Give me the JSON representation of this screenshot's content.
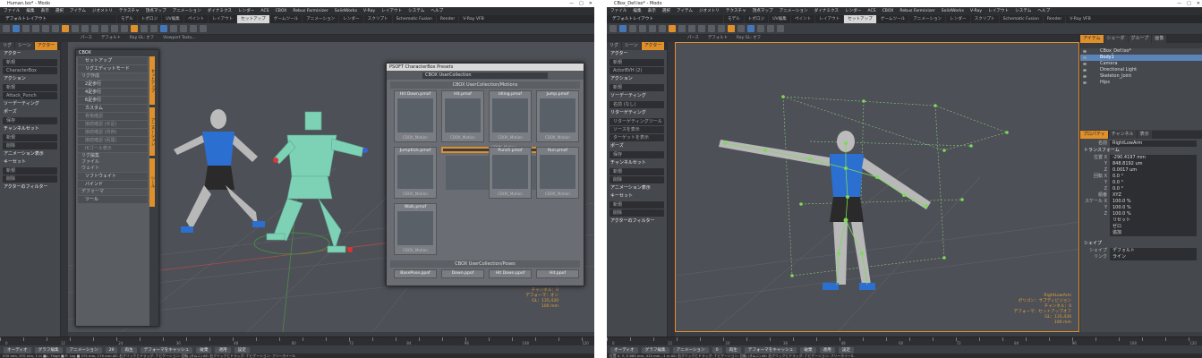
{
  "left": {
    "title": "Human.lxo* - Modo",
    "menu": [
      "ファイル",
      "編集",
      "表示",
      "選択",
      "アイテム",
      "ジオメトリ",
      "テクスチャ",
      "頂点マップ",
      "アニメーション",
      "ダイナミクス",
      "レンダー",
      "ACS",
      "CBOX",
      "Rebus Farminizer",
      "SolidWorks",
      "V-Ray",
      "レイアウト",
      "システム",
      "ヘルプ"
    ],
    "layout_label": "デフォルトレイアウト",
    "tabs": [
      "モデル",
      "トポロジ",
      "UV編集",
      "ペイント",
      "レイアウト",
      "セットアップ",
      "ゲームツール",
      "アニメーション",
      "レンダー",
      "スクリプト",
      "Schematic Fusion",
      "Render",
      "V-Ray VFB"
    ],
    "active_tab": "セットアップ",
    "vp_tabs": [
      "パース",
      "デフォルト",
      "Ray GL: オフ",
      "Viewport Textu..."
    ],
    "panel": {
      "tabs": [
        "リグ",
        "シーン",
        "アクター"
      ],
      "rows": [
        "アクター",
        "新規",
        "CharacterBox",
        "アクション",
        "新規",
        "Attack_Punch",
        "ソーデーティング",
        "ポーズ",
        "保存",
        "チャンネルセット",
        "新規",
        "削除",
        "アニメーション表示",
        "キーセット",
        "新規",
        "削除",
        "アクターのフィルター"
      ]
    },
    "cbox": {
      "title": "CBOX",
      "items": [
        "セットアップ",
        "リグエディットモード",
        "リグ作成",
        "2足歩行",
        "4足歩行",
        "6足歩行",
        "カスタム",
        "骨格確認",
        "接続確認 (手足)",
        "接続確認 (背骨)",
        "接続確認 (尻尾)",
        "IKゴール表示",
        "リグ編集",
        "ファイル",
        "ウェイト",
        "ソフトウェイト",
        "バインド",
        "デフォーマ",
        "ツール"
      ],
      "side": [
        "セットアップ",
        "アニメーション",
        "ツール"
      ]
    },
    "psoft": {
      "title": "PSOFT CharacterBox Presets",
      "dropdown": "CBOX UserCollection",
      "section_motions": "CBOX UserCollection/Motions",
      "section_poses": "CBOX UserCollection/Poses",
      "cells": [
        {
          "name": "Hit Down.pmof",
          "cap": "CBOX_Motion"
        },
        {
          "name": "Hit.pmof",
          "cap": "CBOX_Motion"
        },
        {
          "name": "Idling.pmof",
          "cap": "CBOX_Motion"
        },
        {
          "name": "Jump.pmof",
          "cap": "CBOX_Motion"
        },
        {
          "name": "JumpKick.pmof",
          "cap": "CBOX_Motion"
        },
        {
          "name": "Kick.pmof",
          "cap": "CBOX_Motion"
        },
        {
          "name": "Punch.pmof",
          "cap": "CBOX_Motion"
        },
        {
          "name": "Run.pmof",
          "cap": "CBOX_Motion"
        },
        {
          "name": "Walk.pmof",
          "cap": "CBOX_Motion"
        }
      ],
      "poses": [
        "BasePose.ppof",
        "Down.ppof",
        "Hit Down.ppof",
        "Hit.ppof"
      ]
    },
    "vp_info": [
      "アイテム数",
      "ポリゴン：サブディビジョン",
      "チャンネル：0",
      "デフォーマ：オン",
      "GL：135,430",
      "100 mm"
    ],
    "timeline": [
      "0",
      "12",
      "24",
      "36",
      "48",
      "60",
      "72",
      "84",
      "96",
      "108",
      "120"
    ],
    "bottom": [
      "オーディオ",
      "グラフ編集",
      "アニメーション",
      "29",
      "再生",
      "デフォーマをキャッシュ",
      "破棄",
      "適用",
      "設定"
    ],
    "status": "530 mm, 970 mm, 1 m  ■L: Thigh ■ P: Leg ■ 375 mm, 179 mm  AE: 右クリックとドラッグ: ナビゲーション: 回転 (オムニ) AE: 右クリックとドラッグ: ナビゲーション: フリーホイール"
  },
  "right": {
    "title": "CBox_Def.lxo* - Modo",
    "menu": [
      "ファイル",
      "編集",
      "表示",
      "選択",
      "アイテム",
      "ジオメトリ",
      "テクスチャ",
      "頂点マップ",
      "アニメーション",
      "ダイナミクス",
      "レンダー",
      "ACS",
      "CBOX",
      "Rebus Farminizer",
      "SolidWorks",
      "V-Ray",
      "レイアウト",
      "システム",
      "ヘルプ"
    ],
    "layout_label": "デフォルトレイアウト",
    "tabs": [
      "モデル",
      "トポロジ",
      "UV編集",
      "ペイント",
      "レイアウト",
      "セットアップ",
      "ゲームツール",
      "アニメーション",
      "レンダー",
      "スクリプト",
      "Schematic Fusion",
      "Render",
      "V-Ray VFB"
    ],
    "active_tab": "セットアップ",
    "vp_tabs": [
      "パース",
      "デフォルト",
      "Ray GL: オフ"
    ],
    "panel": {
      "tabs": [
        "リグ",
        "シーン",
        "アクター"
      ],
      "rows": [
        "アクター",
        "新規",
        "ActorBVH (2)",
        "アクション",
        "新規",
        "ソーデーティング",
        "名前 (なし)",
        "リターゲティング",
        "リターゲティングツール",
        "ソースを表示",
        "ターゲットを表示",
        "ポーズ",
        "保存",
        "チャンネルセット",
        "新規",
        "削除",
        "アニメーション表示",
        "キーセット",
        "新規",
        "削除",
        "アクターのフィルター"
      ]
    },
    "outliner": {
      "tabs": [
        "アイテム",
        "シェーダ",
        "グループ",
        "画像"
      ],
      "items": [
        {
          "name": "CBox_Def.lxo*",
          "sel": false
        },
        {
          "name": "Body1",
          "sel": true
        },
        {
          "name": "Camera",
          "sel": false
        },
        {
          "name": "Directional Light",
          "sel": false
        },
        {
          "name": "Skeleton_Joint",
          "sel": false
        },
        {
          "name": "Hips",
          "sel": false
        }
      ]
    },
    "props": {
      "tabs": [
        "プロパティ",
        "チャンネル",
        "表示"
      ],
      "name_label": "名前",
      "name_value": "RightLowArm",
      "transform": "トランスフォーム",
      "rows": [
        {
          "l": "位置 X",
          "v": "-290.4197 mm"
        },
        {
          "l": "Y",
          "v": "848.8192 um"
        },
        {
          "l": "Z",
          "v": "0.0017 um"
        },
        {
          "l": "回転 X",
          "v": "0.0 °"
        },
        {
          "l": "Y",
          "v": "0.0 °"
        },
        {
          "l": "Z",
          "v": "0.0 °"
        },
        {
          "l": "順番",
          "v": "XYZ"
        },
        {
          "l": "スケール X",
          "v": "100.0 %"
        },
        {
          "l": "Y",
          "v": "100.0 %"
        },
        {
          "l": "Z",
          "v": "100.0 %"
        },
        {
          "l": "",
          "v": "リセット"
        },
        {
          "l": "",
          "v": "ゼロ"
        },
        {
          "l": "",
          "v": "追加"
        }
      ],
      "shape_label": "シェイプ",
      "shape_value": "デフォルト",
      "link_label": "リンク",
      "link_value": "ライン"
    },
    "vp_info": [
      "RightLowArm",
      "ポリゴン：サブディビジョン",
      "チャンネル：0",
      "デフォーマ：セットアップオフ",
      "GL：135,430",
      "100 mm"
    ],
    "timeline": [
      "0",
      "12",
      "24",
      "36",
      "48",
      "60",
      "72",
      "84",
      "96",
      "108",
      "120"
    ],
    "bottom": [
      "オーディオ",
      "グラフ編集",
      "アニメーション",
      "0",
      "再生",
      "デフォーマをキャッシュ",
      "破棄",
      "適用",
      "設定"
    ],
    "status": "位置 X, Y, Z   885 mm, 415 mm, -1 m   AE: 右クリックとドラッグ: ナビゲーション: 回転 (オムニ) AE: 右クリックとドラッグ: ナビゲーション: フリーホイール"
  },
  "colors": {
    "accent": "#e0902a",
    "select": "#5b84b8",
    "viewport": "#4d5056",
    "panel": "#45484d"
  }
}
